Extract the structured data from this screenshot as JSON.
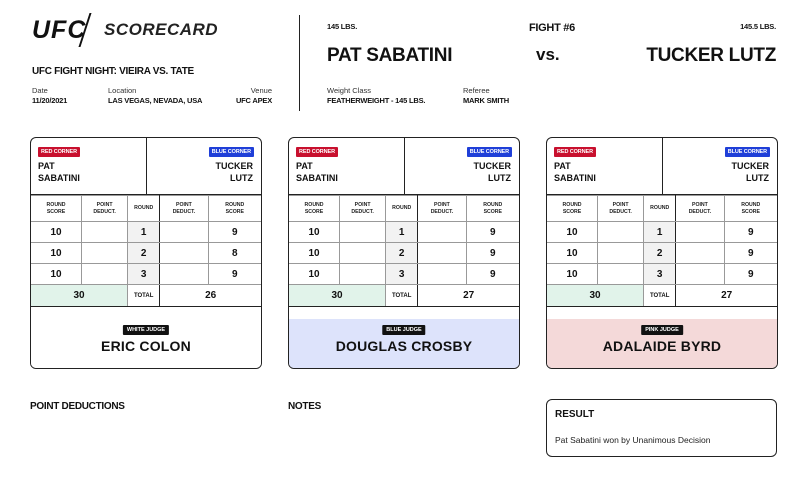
{
  "header": {
    "logo": "UFC",
    "title": "SCORECARD",
    "event_name": "UFC FIGHT NIGHT: VIEIRA VS. TATE",
    "date_label": "Date",
    "date": "11/20/2021",
    "location_label": "Location",
    "location": "LAS VEGAS, NEVADA, USA",
    "venue_label": "Venue",
    "venue": "UFC APEX"
  },
  "fight": {
    "number": "FIGHT #6",
    "vs": "vs.",
    "red_weight": "145 LBS.",
    "red_fighter": "PAT SABATINI",
    "blue_weight": "145.5 LBS.",
    "blue_fighter": "TUCKER LUTZ",
    "weight_class_label": "Weight Class",
    "weight_class": "FEATHERWEIGHT - 145 LBS.",
    "referee_label": "Referee",
    "referee": "MARK SMITH"
  },
  "labels": {
    "red_corner": "RED CORNER",
    "blue_corner": "BLUE CORNER",
    "red_first": "PAT",
    "red_last": "SABATINI",
    "blue_first": "TUCKER",
    "blue_last": "LUTZ",
    "round_score_1": "ROUND",
    "round_score_2": "SCORE",
    "point_deduct_1": "POINT",
    "point_deduct_2": "DEDUCT.",
    "round": "ROUND",
    "total": "TOTAL"
  },
  "judges": [
    {
      "badge": "WHITE JUDGE",
      "name": "ERIC COLON",
      "bg": "#ffffff",
      "rounds": [
        {
          "round": "1",
          "red": "10",
          "red_ded": "",
          "blue_ded": "",
          "blue": "9"
        },
        {
          "round": "2",
          "red": "10",
          "red_ded": "",
          "blue_ded": "",
          "blue": "8"
        },
        {
          "round": "3",
          "red": "10",
          "red_ded": "",
          "blue_ded": "",
          "blue": "9"
        }
      ],
      "red_total": "30",
      "blue_total": "26"
    },
    {
      "badge": "BLUE JUDGE",
      "name": "DOUGLAS CROSBY",
      "bg": "#dde3fb",
      "rounds": [
        {
          "round": "1",
          "red": "10",
          "red_ded": "",
          "blue_ded": "",
          "blue": "9"
        },
        {
          "round": "2",
          "red": "10",
          "red_ded": "",
          "blue_ded": "",
          "blue": "9"
        },
        {
          "round": "3",
          "red": "10",
          "red_ded": "",
          "blue_ded": "",
          "blue": "9"
        }
      ],
      "red_total": "30",
      "blue_total": "27"
    },
    {
      "badge": "PINK JUDGE",
      "name": "ADALAIDE BYRD",
      "bg": "#f4d9d9",
      "rounds": [
        {
          "round": "1",
          "red": "10",
          "red_ded": "",
          "blue_ded": "",
          "blue": "9"
        },
        {
          "round": "2",
          "red": "10",
          "red_ded": "",
          "blue_ded": "",
          "blue": "9"
        },
        {
          "round": "3",
          "red": "10",
          "red_ded": "",
          "blue_ded": "",
          "blue": "9"
        }
      ],
      "red_total": "30",
      "blue_total": "27"
    }
  ],
  "sections": {
    "point_deductions": "POINT DEDUCTIONS",
    "notes": "NOTES",
    "result_title": "RESULT",
    "result_text": "Pat Sabatini won by Unanimous Decision"
  }
}
